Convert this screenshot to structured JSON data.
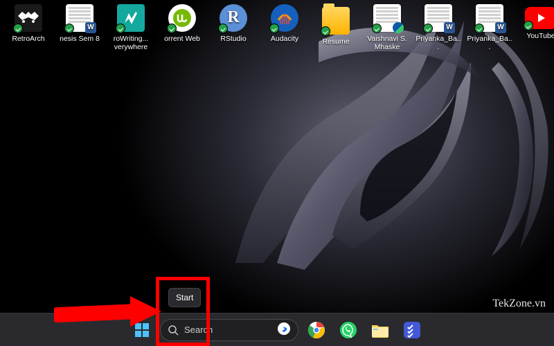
{
  "desktop": {
    "icons": [
      {
        "name": "retroarch",
        "label": "RetroArch"
      },
      {
        "name": "thesis-sem8",
        "label": "nesis Sem 8"
      },
      {
        "name": "prowriting",
        "label": "roWriting...\nverywhere"
      },
      {
        "name": "torrent-web",
        "label": "orrent Web"
      },
      {
        "name": "rstudio",
        "label": "RStudio"
      },
      {
        "name": "audacity",
        "label": "Audacity"
      },
      {
        "name": "resume",
        "label": "Resume"
      },
      {
        "name": "vaishnavi-doc",
        "label": "Vaishnavi S.\nMhaske"
      },
      {
        "name": "priyanka-ba-1",
        "label": "Priyanka_Ba..."
      },
      {
        "name": "priyanka-ba-2",
        "label": "Priyanka_Ba..."
      },
      {
        "name": "youtube",
        "label": "YouTube"
      }
    ]
  },
  "taskbar": {
    "start_tooltip": "Start",
    "search_placeholder": "Search"
  },
  "watermark": "TekZone.vn",
  "annotation": {
    "arrow_color": "#ff0000",
    "box_color": "#ff0000"
  }
}
